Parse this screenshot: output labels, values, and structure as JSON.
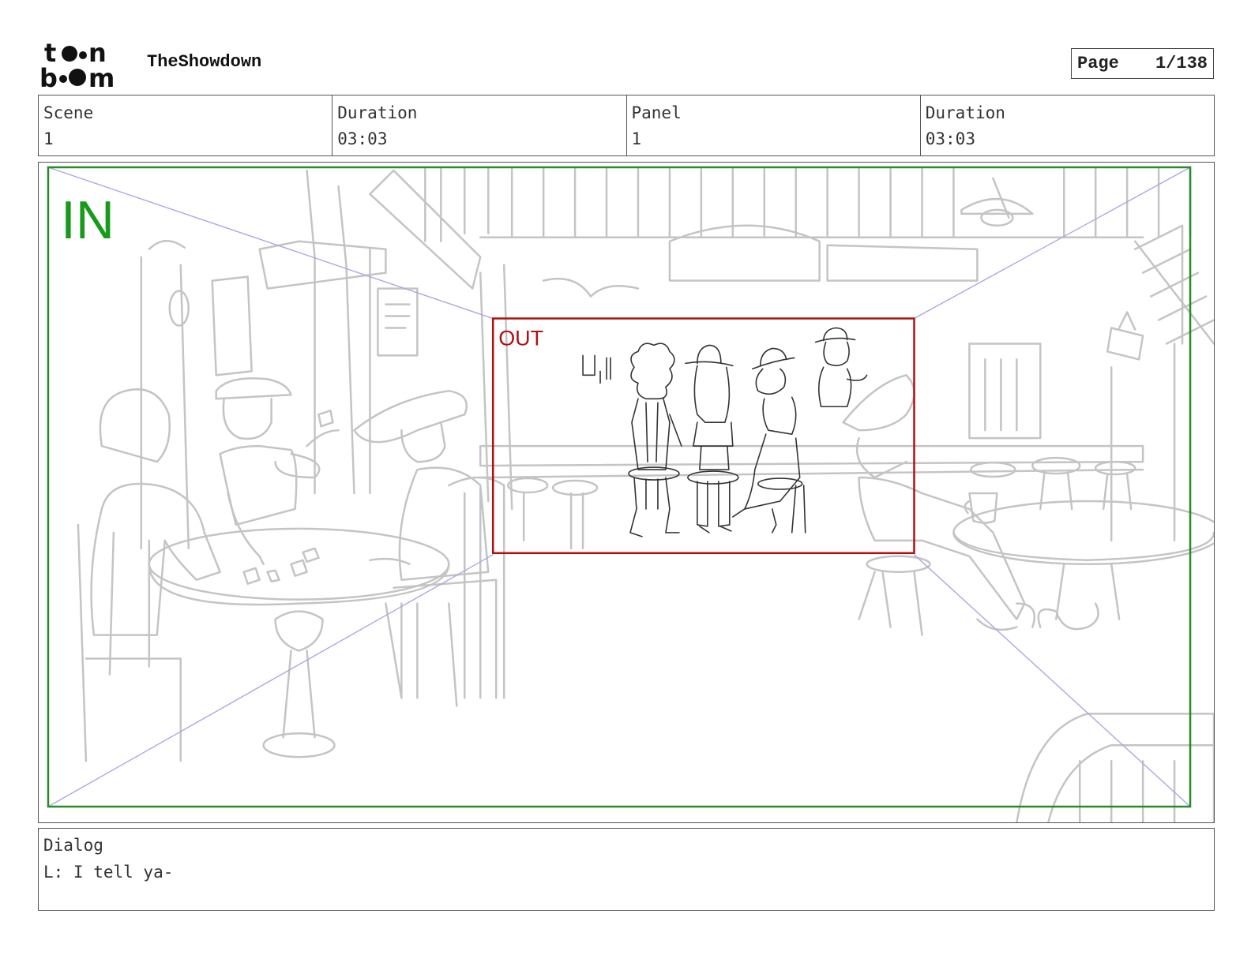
{
  "header": {
    "project_title": "TheShowdown",
    "page_label": "Page",
    "page_number": "1/138"
  },
  "info": {
    "scene_label": "Scene",
    "scene_value": "1",
    "scene_duration_label": "Duration",
    "scene_duration_value": "03:03",
    "panel_label": "Panel",
    "panel_value": "1",
    "panel_duration_label": "Duration",
    "panel_duration_value": "03:03"
  },
  "panel": {
    "in_label": "IN",
    "out_label": "OUT",
    "in_color": "#1a9a1a",
    "out_color": "#b01010",
    "guide_color": "#9a9ae0"
  },
  "dialog": {
    "label": "Dialog",
    "text": "L: I tell ya-"
  }
}
